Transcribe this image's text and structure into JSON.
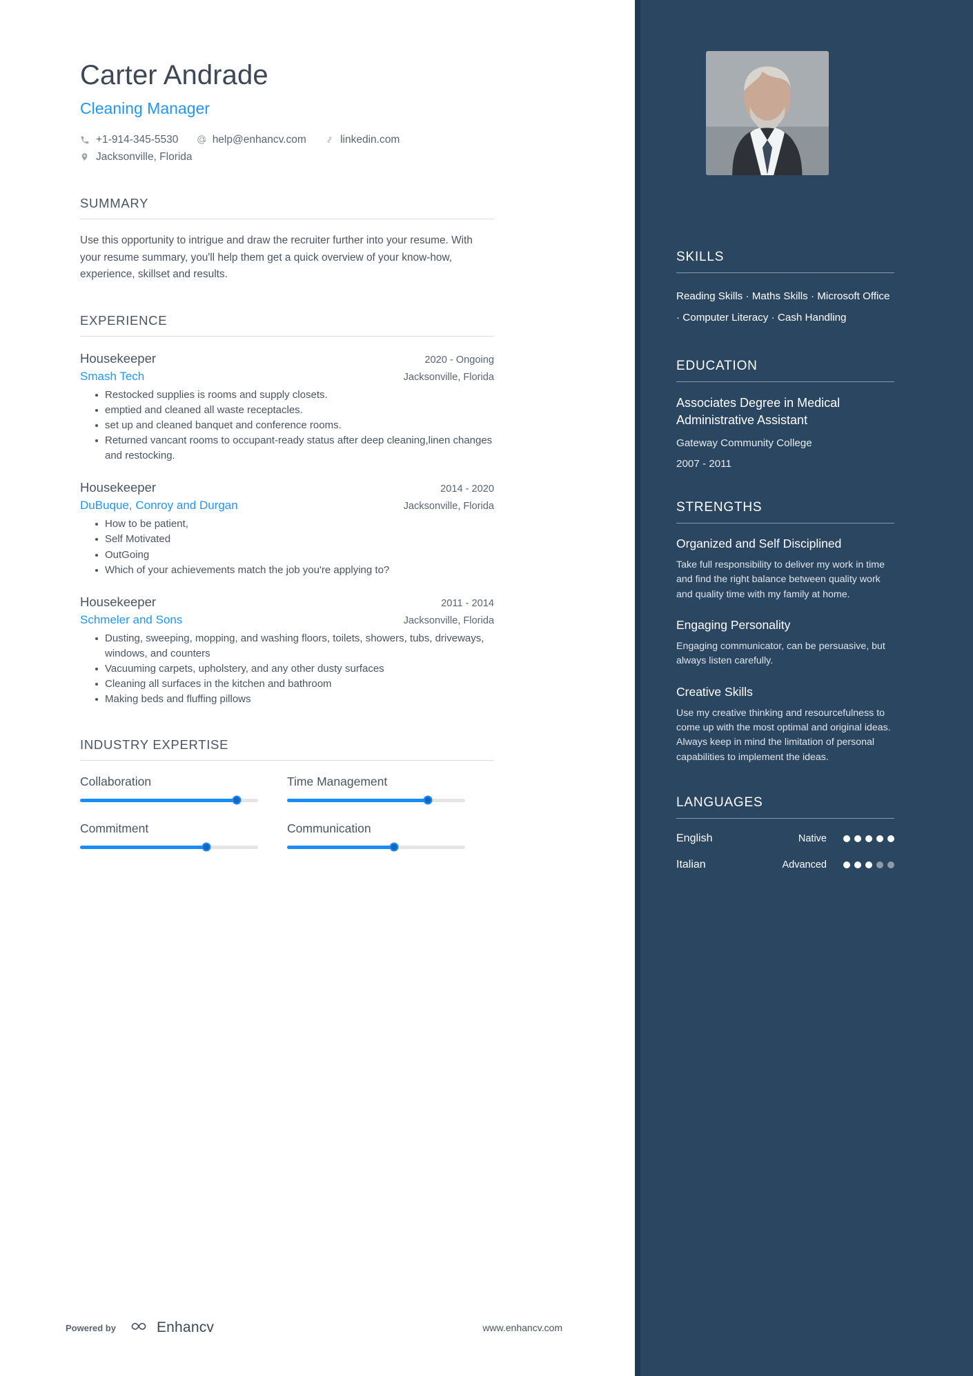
{
  "header": {
    "name": "Carter Andrade",
    "job_title": "Cleaning Manager",
    "phone": "+1-914-345-5530",
    "email": "help@enhancv.com",
    "website": "linkedin.com",
    "location": "Jacksonville, Florida"
  },
  "summary": {
    "title": "SUMMARY",
    "text": "Use this opportunity to intrigue and draw the recruiter further into your resume. With your resume summary, you'll help them get a quick overview of your know-how, experience, skillset and results."
  },
  "experience": {
    "title": "EXPERIENCE",
    "entries": [
      {
        "role": "Housekeeper",
        "company": "Smash Tech",
        "date": "2020 - Ongoing",
        "location": "Jacksonville, Florida",
        "bullets": [
          "Restocked supplies is rooms and supply closets.",
          "emptied and cleaned all waste receptacles.",
          "set up and cleaned banquet and conference rooms.",
          "Returned vancant rooms to occupant-ready status after deep cleaning,linen changes and restocking."
        ]
      },
      {
        "role": "Housekeeper",
        "company": "DuBuque, Conroy and Durgan",
        "date": "2014 - 2020",
        "location": "Jacksonville, Florida",
        "bullets": [
          "How to be patient,",
          "Self Motivated",
          "OutGoing",
          "Which of your achievements match the job you're applying to?"
        ]
      },
      {
        "role": "Housekeeper",
        "company": "Schmeler and Sons",
        "date": "2011 - 2014",
        "location": "Jacksonville, Florida",
        "bullets": [
          "Dusting, sweeping, mopping, and washing floors, toilets, showers, tubs, driveways, windows, and counters",
          "Vacuuming carpets, upholstery, and any other dusty surfaces",
          "Cleaning all surfaces in the kitchen and bathroom",
          "Making beds and fluffing pillows"
        ]
      }
    ]
  },
  "industry_expertise": {
    "title": "INDUSTRY EXPERTISE",
    "items": [
      {
        "label": "Collaboration",
        "value": 88
      },
      {
        "label": "Time Management",
        "value": 79
      },
      {
        "label": "Commitment",
        "value": 71
      },
      {
        "label": "Communication",
        "value": 60
      }
    ]
  },
  "sidebar": {
    "skills": {
      "title": "SKILLS",
      "text": "Reading Skills · Maths Skills · Microsoft Office · Computer Literacy · Cash Handling"
    },
    "education": {
      "title": "EDUCATION",
      "degree": "Associates Degree in Medical Administrative Assistant",
      "school": "Gateway Community College",
      "date": "2007 - 2011"
    },
    "strengths": {
      "title": "STRENGTHS",
      "items": [
        {
          "name": "Organized and Self Disciplined",
          "text": "Take full responsibility to deliver my work in time and find the right balance between quality work and quality time with my family at home."
        },
        {
          "name": "Engaging Personality",
          "text": "Engaging communicator, can be persuasive, but always listen carefully."
        },
        {
          "name": "Creative Skills",
          "text": "Use my creative thinking and resourcefulness to come up with the most optimal and original ideas. Always keep in mind the limitation of personal capabilities to implement the ideas."
        }
      ]
    },
    "languages": {
      "title": "LANGUAGES",
      "items": [
        {
          "name": "English",
          "level": "Native",
          "dots": 5
        },
        {
          "name": "Italian",
          "level": "Advanced",
          "dots": 3
        }
      ]
    }
  },
  "footer": {
    "powered_by": "Powered by",
    "brand": "Enhancv",
    "url": "www.enhancv.com"
  },
  "colors": {
    "accent": "#2196f3",
    "sidebar_bg": "#2b4660",
    "sidebar_edge": "#22384f",
    "text": "#4a5462"
  }
}
